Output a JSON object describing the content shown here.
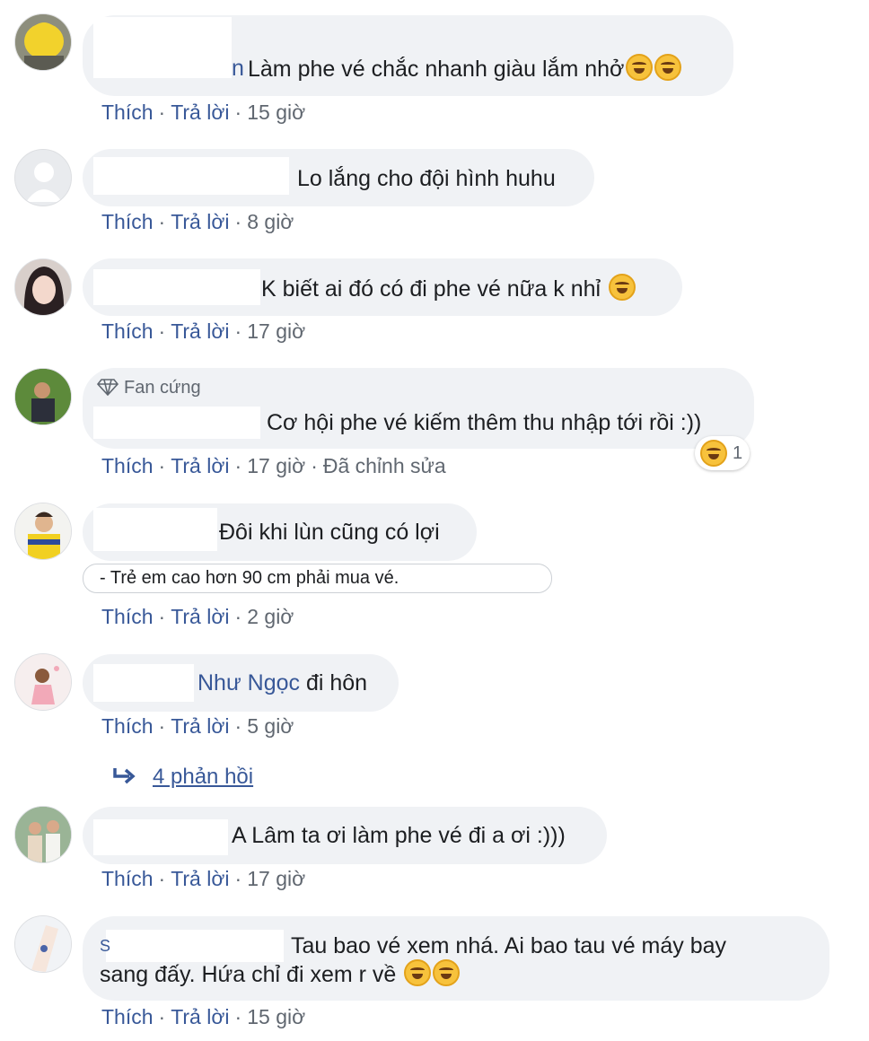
{
  "comments": [
    {
      "text": "Làm phe vé chắc nhanh giàu lắm nhở",
      "name_fragment": "n",
      "emojis": [
        "laughing-tears",
        "laughing-tears"
      ],
      "actions": {
        "like": "Thích",
        "reply": "Trả lời",
        "time": "15 giờ"
      }
    },
    {
      "text": "Lo lắng cho đội hình huhu",
      "actions": {
        "like": "Thích",
        "reply": "Trả lời",
        "time": "8 giờ"
      }
    },
    {
      "text": "K biết ai đó có đi phe vé nữa k nhỉ",
      "emojis": [
        "rofl"
      ],
      "actions": {
        "like": "Thích",
        "reply": "Trả lời",
        "time": "17 giờ"
      }
    },
    {
      "badge": "Fan cứng",
      "text": "Cơ hội phe vé kiếm thêm thu nhập tới rồi :))",
      "reaction_count": "1",
      "actions": {
        "like": "Thích",
        "reply": "Trả lời",
        "time": "17 giờ",
        "edited": "Đã chỉnh sửa"
      }
    },
    {
      "text": "Đôi khi lùn cũng có lợi",
      "attachment_text": "- Trẻ em cao hơn 90 cm phải mua vé.",
      "actions": {
        "like": "Thích",
        "reply": "Trả lời",
        "time": "2 giờ"
      }
    },
    {
      "mention": "Như Ngọc",
      "text": " đi hôn",
      "actions": {
        "like": "Thích",
        "reply": "Trả lời",
        "time": "5 giờ"
      }
    },
    {
      "text": "A Lâm ta ơi làm phe vé đi a ơi :)))",
      "actions": {
        "like": "Thích",
        "reply": "Trả lời",
        "time": "17 giờ"
      }
    },
    {
      "text_line1": "Tau bao vé xem nhá. Ai bao tau vé máy bay",
      "text_line2": "sang đấy. Hứa chỉ đi xem r về",
      "name_fragment": "S",
      "emojis": [
        "rofl",
        "rofl"
      ],
      "actions": {
        "like": "Thích",
        "reply": "Trả lời",
        "time": "15 giờ"
      }
    }
  ],
  "replies_link": "4 phản hồi",
  "colors": {
    "link": "#385898",
    "bubble": "#f0f2f5",
    "meta": "#606770",
    "text": "#1c1e21"
  }
}
